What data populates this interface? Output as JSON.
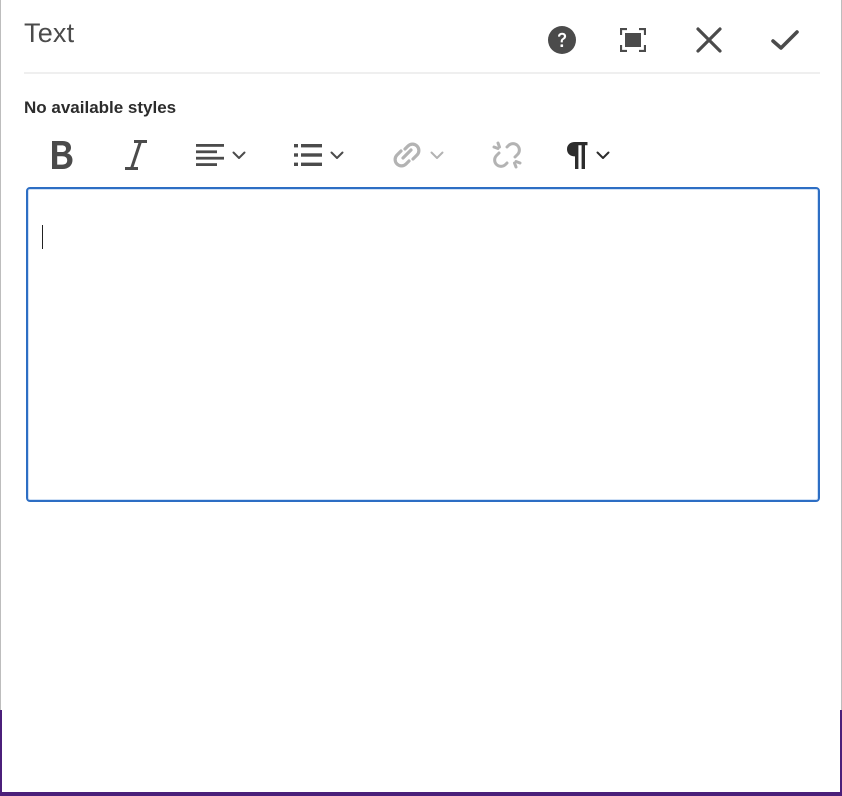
{
  "dialog": {
    "title": "Text",
    "header_actions": [
      {
        "name": "help-icon",
        "label": "Help"
      },
      {
        "name": "fullscreen-icon",
        "label": "Toggle fullscreen"
      },
      {
        "name": "close-icon",
        "label": "Cancel"
      },
      {
        "name": "check-icon",
        "label": "Done"
      }
    ]
  },
  "styles": {
    "label": "No available styles"
  },
  "toolbar": {
    "items": [
      {
        "icon": "bold-icon",
        "enabled": true
      },
      {
        "icon": "italic-icon",
        "enabled": true
      },
      {
        "icon": "align-icon",
        "enabled": true,
        "dropdown": true
      },
      {
        "icon": "list-icon",
        "enabled": true,
        "dropdown": true
      },
      {
        "icon": "link-icon",
        "enabled": false,
        "dropdown": true
      },
      {
        "icon": "unlink-icon",
        "enabled": false
      },
      {
        "icon": "paragraph-icon",
        "enabled": true,
        "dropdown": true
      }
    ]
  },
  "editor": {
    "value": ""
  },
  "colors": {
    "accent": "#2d6ec4",
    "icon": "#4b4b4b",
    "icon_disabled": "#b3b3b3",
    "backdrop": "#4b1f7a"
  }
}
